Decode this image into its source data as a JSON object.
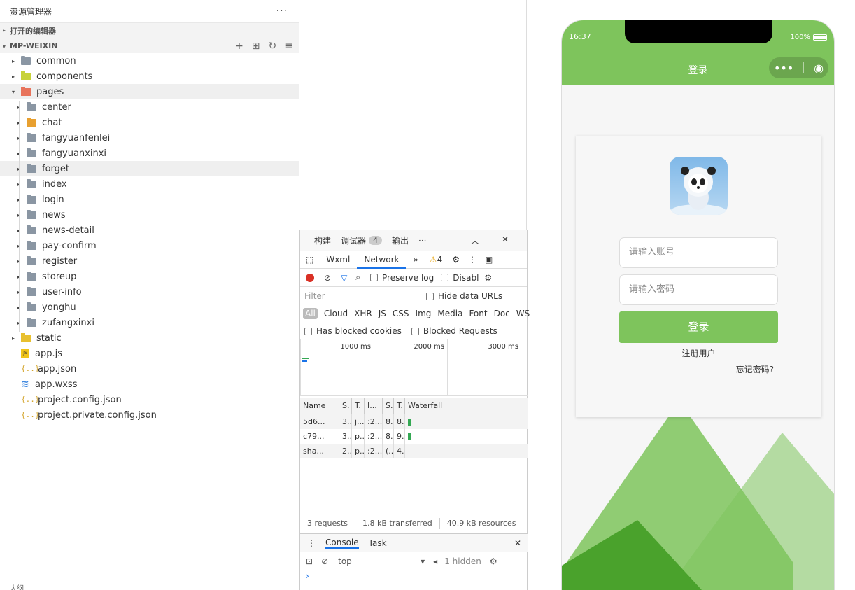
{
  "explorer": {
    "title": "资源管理器",
    "more": "···",
    "open_editors": "打开的编辑器",
    "project": "MP-WEIXIN",
    "bottom_label": "大纲",
    "items": [
      {
        "label": "common",
        "type": "folder",
        "depth": 0,
        "arrow": "▸"
      },
      {
        "label": "components",
        "type": "fcomp",
        "depth": 0,
        "arrow": "▸"
      },
      {
        "label": "pages",
        "type": "fpages",
        "depth": 0,
        "arrow": "▾"
      },
      {
        "label": "center",
        "type": "folder",
        "depth": 1,
        "arrow": "▸"
      },
      {
        "label": "chat",
        "type": "fchat",
        "depth": 1,
        "arrow": "▸"
      },
      {
        "label": "fangyuanfenlei",
        "type": "folder",
        "depth": 1,
        "arrow": "▸"
      },
      {
        "label": "fangyuanxinxi",
        "type": "folder",
        "depth": 1,
        "arrow": "▸"
      },
      {
        "label": "forget",
        "type": "folder",
        "depth": 1,
        "arrow": "▸"
      },
      {
        "label": "index",
        "type": "folder",
        "depth": 1,
        "arrow": "▸"
      },
      {
        "label": "login",
        "type": "folder",
        "depth": 1,
        "arrow": "▸"
      },
      {
        "label": "news",
        "type": "folder",
        "depth": 1,
        "arrow": "▸"
      },
      {
        "label": "news-detail",
        "type": "folder",
        "depth": 1,
        "arrow": "▸"
      },
      {
        "label": "pay-confirm",
        "type": "folder",
        "depth": 1,
        "arrow": "▸"
      },
      {
        "label": "register",
        "type": "folder",
        "depth": 1,
        "arrow": "▸"
      },
      {
        "label": "storeup",
        "type": "folder",
        "depth": 1,
        "arrow": "▸"
      },
      {
        "label": "user-info",
        "type": "folder",
        "depth": 1,
        "arrow": "▸"
      },
      {
        "label": "yonghu",
        "type": "folder",
        "depth": 1,
        "arrow": "▸"
      },
      {
        "label": "zufangxinxi",
        "type": "folder",
        "depth": 1,
        "arrow": "▸"
      },
      {
        "label": "static",
        "type": "fstatic",
        "depth": 0,
        "arrow": "▸"
      },
      {
        "label": "app.js",
        "type": "js",
        "depth": 0,
        "arrow": ""
      },
      {
        "label": "app.json",
        "type": "json",
        "depth": 0,
        "arrow": ""
      },
      {
        "label": "app.wxss",
        "type": "wxss",
        "depth": 0,
        "arrow": ""
      },
      {
        "label": "project.config.json",
        "type": "json",
        "depth": 0,
        "arrow": ""
      },
      {
        "label": "project.private.config.json",
        "type": "json",
        "depth": 0,
        "arrow": ""
      }
    ]
  },
  "devtools": {
    "tab_build": "构建",
    "tab_debugger": "调试器",
    "debugger_badge": "4",
    "tab_output": "输出",
    "more": "···",
    "panel_wxml": "Wxml",
    "panel_network": "Network",
    "panel_more": "»",
    "warn_count": "4",
    "preserve_log": "Preserve log",
    "disable": "Disabl",
    "filter_placeholder": "Filter",
    "hide_data_urls": "Hide data URLs",
    "types": [
      "All",
      "Cloud",
      "XHR",
      "JS",
      "CSS",
      "Img",
      "Media",
      "Font",
      "Doc",
      "WS"
    ],
    "blocked_cookies": "Has blocked cookies",
    "blocked_requests": "Blocked Requests",
    "ticks": [
      "1000 ms",
      "2000 ms",
      "3000 ms"
    ],
    "columns": [
      "Name",
      "S.",
      "T.",
      "I...",
      "S.",
      "T.",
      "Waterfall"
    ],
    "rows": [
      [
        "5d6...",
        "3..",
        "j...",
        ":2...",
        "8..",
        "8.."
      ],
      [
        "c79...",
        "3..",
        "p..",
        ":2...",
        "8..",
        "9.."
      ],
      [
        "sha...",
        "2..",
        "p..",
        ":2...",
        "(...",
        "4.."
      ]
    ],
    "summary_requests": "3 requests",
    "summary_transferred": "1.8 kB transferred",
    "summary_resources": "40.9 kB resources",
    "console_tab": "Console",
    "task_tab": "Task",
    "context": "top",
    "hidden": "1 hidden",
    "prompt": "›"
  },
  "phone": {
    "time": "16:37",
    "battery": "100%",
    "nav_title": "登录",
    "account_placeholder": "请输入账号",
    "password_placeholder": "请输入密码",
    "login_button": "登录",
    "register_link": "注册用户",
    "forgot_link": "忘记密码?",
    "theme_color": "#7ec45c"
  }
}
